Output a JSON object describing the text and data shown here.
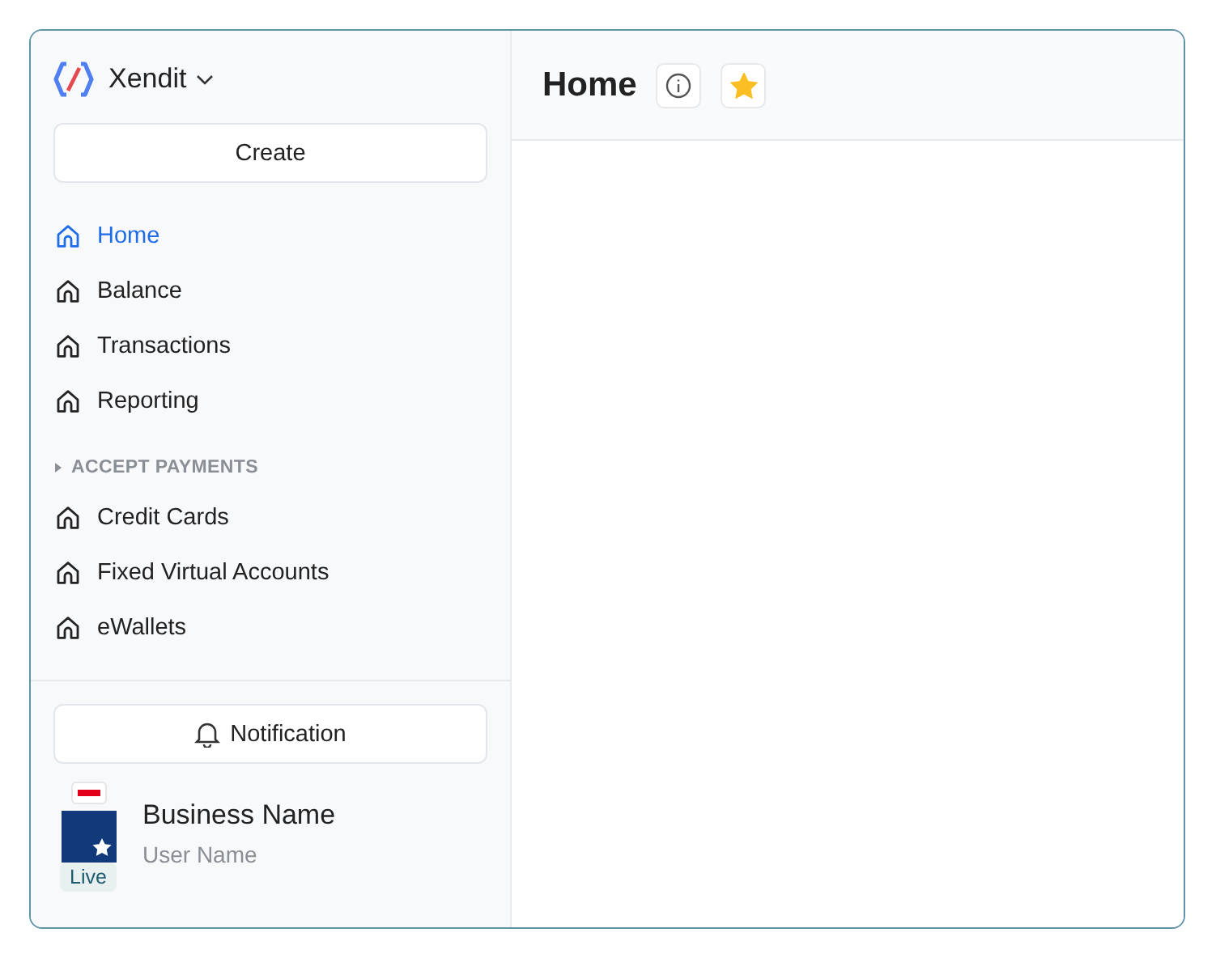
{
  "brand": {
    "name": "Xendit"
  },
  "create_button": {
    "label": "Create"
  },
  "nav": {
    "items": [
      {
        "label": "Home",
        "selected": true
      },
      {
        "label": "Balance",
        "selected": false
      },
      {
        "label": "Transactions",
        "selected": false
      },
      {
        "label": "Reporting",
        "selected": false
      }
    ],
    "sections": [
      {
        "title": "ACCEPT PAYMENTS",
        "expanded": true,
        "items": [
          {
            "label": "Credit Cards",
            "selected": false
          },
          {
            "label": "Fixed Virtual Accounts",
            "selected": false
          },
          {
            "label": "eWallets",
            "selected": false
          }
        ]
      }
    ]
  },
  "notification_button": {
    "label": "Notification"
  },
  "profile": {
    "business_name": "Business Name",
    "user_name": "User Name",
    "environment": "Live"
  },
  "header": {
    "title": "Home",
    "favorite": true
  }
}
